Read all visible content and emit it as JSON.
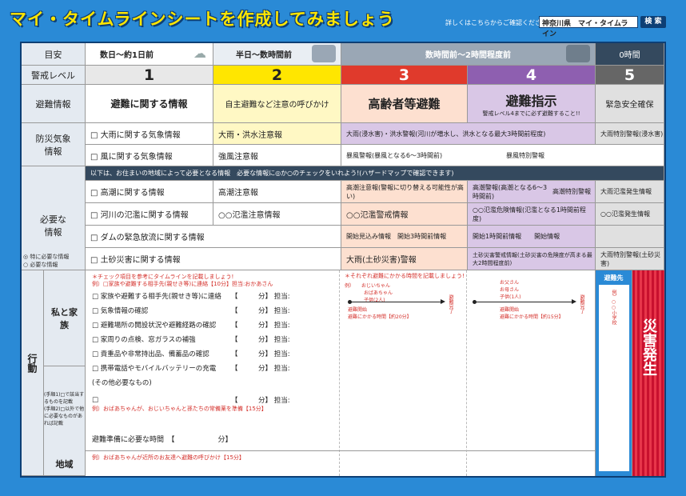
{
  "header": {
    "title": "マイ・タイムラインシートを作成してみましょう",
    "search_note": "詳しくはこちらからご確認ください",
    "search_value": "神奈川県　マイ・タイムライン",
    "search_button": "検 索"
  },
  "timeline_row": {
    "label": "目安",
    "cols": [
      "数日〜約1日前",
      "半日〜数時間前",
      "数時間前〜2時間程度前",
      "0時間"
    ]
  },
  "level_row": {
    "label": "警戒レベル",
    "levels": [
      "1",
      "2",
      "3",
      "4",
      "5"
    ]
  },
  "evac_info_row": {
    "label": "避難情報",
    "l1": "避難に関する情報",
    "l2": "自主避難など注意の呼びかけ",
    "l3": "高齢者等避難",
    "l4_main": "避難指示",
    "l4_sub": "警戒レベル4までに必ず避難すること!!",
    "l5": "緊急安全確保"
  },
  "weather": {
    "label": "防災気象情報",
    "rain": {
      "name": "□ 大雨に関する気象情報",
      "l2": "大雨・洪水注意報",
      "l3": "大雨(浸水害)・洪水警報(河川が増水し、洪水となる最大3時間前程度)",
      "l5": "大雨特別警報(浸水害)"
    },
    "wind": {
      "name": "□ 風に関する気象情報",
      "l2": "強風注意報",
      "l3": "暴風警報(暴風となる6〜3時間前)",
      "l4": "暴風特別警報"
    }
  },
  "notice": "以下は、お住まいの地域によって必要となる情報　必要な情報に◎か○のチェックをいれよう!(ハザードマップで確認できます)",
  "needed": {
    "label": "必要な情報",
    "legend": "◎ 特に必要な情報\n○ 必要な情報",
    "rows": [
      {
        "name": "□ 高潮に関する情報",
        "l2": "高潮注意報",
        "l3": "高潮注意報(警報に切り替える可能性が高い)",
        "l4a": "高潮警報(高潮となる6〜3時間前)",
        "l4b": "高潮特別警報",
        "l5": "大雨氾濫発生情報"
      },
      {
        "name": "□ 河川の氾濫に関する情報",
        "l2": "○○氾濫注意情報",
        "l3": "○○氾濫警戒情報",
        "l4": "○○氾濫危険情報(氾濫となる1時間前程度)",
        "l5": "○○氾濫発生情報"
      },
      {
        "name": "□ ダムの緊急放流に関する情報",
        "l3": "開始見込み情報　開始3時間前情報",
        "l4": "開始1時間前情報　　開始情報",
        "l5": ""
      },
      {
        "name": "□ 土砂災害に関する情報",
        "l3": "大雨(土砂災害)警報",
        "l4": "土砂災害警戒情報(土砂災害の危険度が高まる最大2時間程度前)",
        "l5": "大雨特別警報(土砂災害)"
      }
    ]
  },
  "action": {
    "label": "行動",
    "steps": "(手順1)□で該当するものを記載\n(手順2)□以外で他に必要なものがあれば記載",
    "family_label": "私と家族",
    "area_label": "地域",
    "hint": "＊チェック項目を参考にタイムラインを記載しましょう!",
    "example": "例）□家族や避難する相手先(親せき等)に連絡【10分】担当:おかあさん",
    "tasks": [
      "□ 家族や避難する相手先(親せき等)に連絡",
      "□ 気象情報の確認",
      "□ 避難場所の開設状況や避難経路の確認",
      "□ 家周りの点検、窓ガラスの補強",
      "□ 貴重品や非常持出品、備蓄品の確認",
      "□ 携帯電話やモバイルバッテリーの充電",
      "(その他必要なもの)",
      "□"
    ],
    "minutes": "【　　　分】 担当:",
    "other_example": "例）おばあちゃんが、おじいちゃんと孫たちの常備薬を準備【15分】",
    "prep_time": "避難準備に必要な時間　【　　　　　　分】",
    "area_example": "例）おばあちゃんが近所のお友達へ避難の呼びかけ【15分】",
    "mid_hint": "＊それぞれ避難にかかる時間を記載しましょう!",
    "ex1_people": "例）　　おじいちゃん\n　　　　おばあちゃん\n　　　　子供(2人)",
    "ex1_note": "避難開始\n避難にかかる時間【約20分】",
    "ex1_end": "避難完了",
    "ex2_people": "お父さん\nお母さん\n子供(1人)",
    "ex2_note": "避難開始\n避難にかかる時間【約15分】",
    "ex2_end": "避難完了",
    "dest_label": "避難先",
    "dest_example": "例）○○小学校",
    "disaster": "災害発生"
  },
  "colors": {
    "l2": "#fff8c4",
    "l3": "#fde0d0",
    "l4": "#d9c7e6",
    "l5": "#e0e0e0",
    "lv1": "#e8e8e8",
    "lv2": "#ffe600",
    "lv3": "#e03a2c",
    "lv4": "#8e5fb0",
    "lv5": "#666666"
  }
}
